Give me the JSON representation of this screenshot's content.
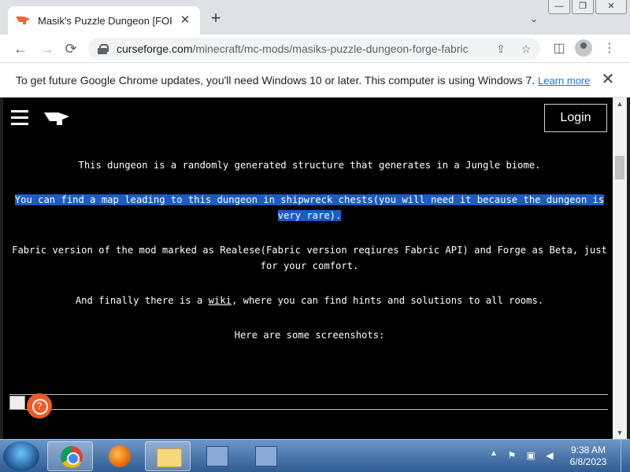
{
  "browser": {
    "tab_title": "Masik's Puzzle Dungeon [FORGE",
    "tab_close_glyph": "✕",
    "new_tab_glyph": "+",
    "url_host": "curseforge.com",
    "url_path": "/minecraft/mc-mods/masiks-puzzle-dungeon-forge-fabric",
    "window_controls": {
      "minimize": "—",
      "restore": "❐",
      "close": "✕"
    }
  },
  "toolbar": {
    "back_glyph": "←",
    "forward_glyph": "→",
    "reload_glyph": "⟳",
    "share_glyph": "⇪",
    "star_glyph": "☆",
    "sidepanel_glyph": "◫",
    "menu_glyph": "⋮"
  },
  "infobar": {
    "message": "To get future Google Chrome updates, you'll need Windows 10 or later. This computer is using Windows 7.",
    "link": "Learn more",
    "close_glyph": "✕"
  },
  "page": {
    "login_label": "Login",
    "paragraphs": {
      "p1": "This dungeon is a randomly generated structure that generates in a Jungle biome.",
      "p2": "You can find a map leading to this dungeon in shipwreck chests(you will need it because the dungeon is very rare).",
      "p3": "Fabric version of the mod marked as Realese(Fabric version reqiures Fabric API) and Forge as Beta, just for your comfort.",
      "p4_before": "And finally there is a ",
      "p4_link": "wiki",
      "p4_after": ", where you can find hints and solutions to all rooms.",
      "p5": "Here are some screenshots:"
    },
    "help_glyph": "?"
  },
  "taskbar": {
    "time": "9:38 AM",
    "date": "6/8/2023",
    "tray_up_glyph": "▲"
  },
  "colors": {
    "selection": "#1c5bc3",
    "help_button": "#f15a24",
    "page_bg": "#000000"
  },
  "icons": [
    "curseforge-favicon",
    "lock-icon",
    "share-icon",
    "star-icon",
    "side-panel-icon",
    "profile-icon",
    "menu-icon",
    "hamburger-icon",
    "curseforge-logo",
    "help-icon",
    "chrome-icon",
    "firefox-icon",
    "folder-icon"
  ]
}
